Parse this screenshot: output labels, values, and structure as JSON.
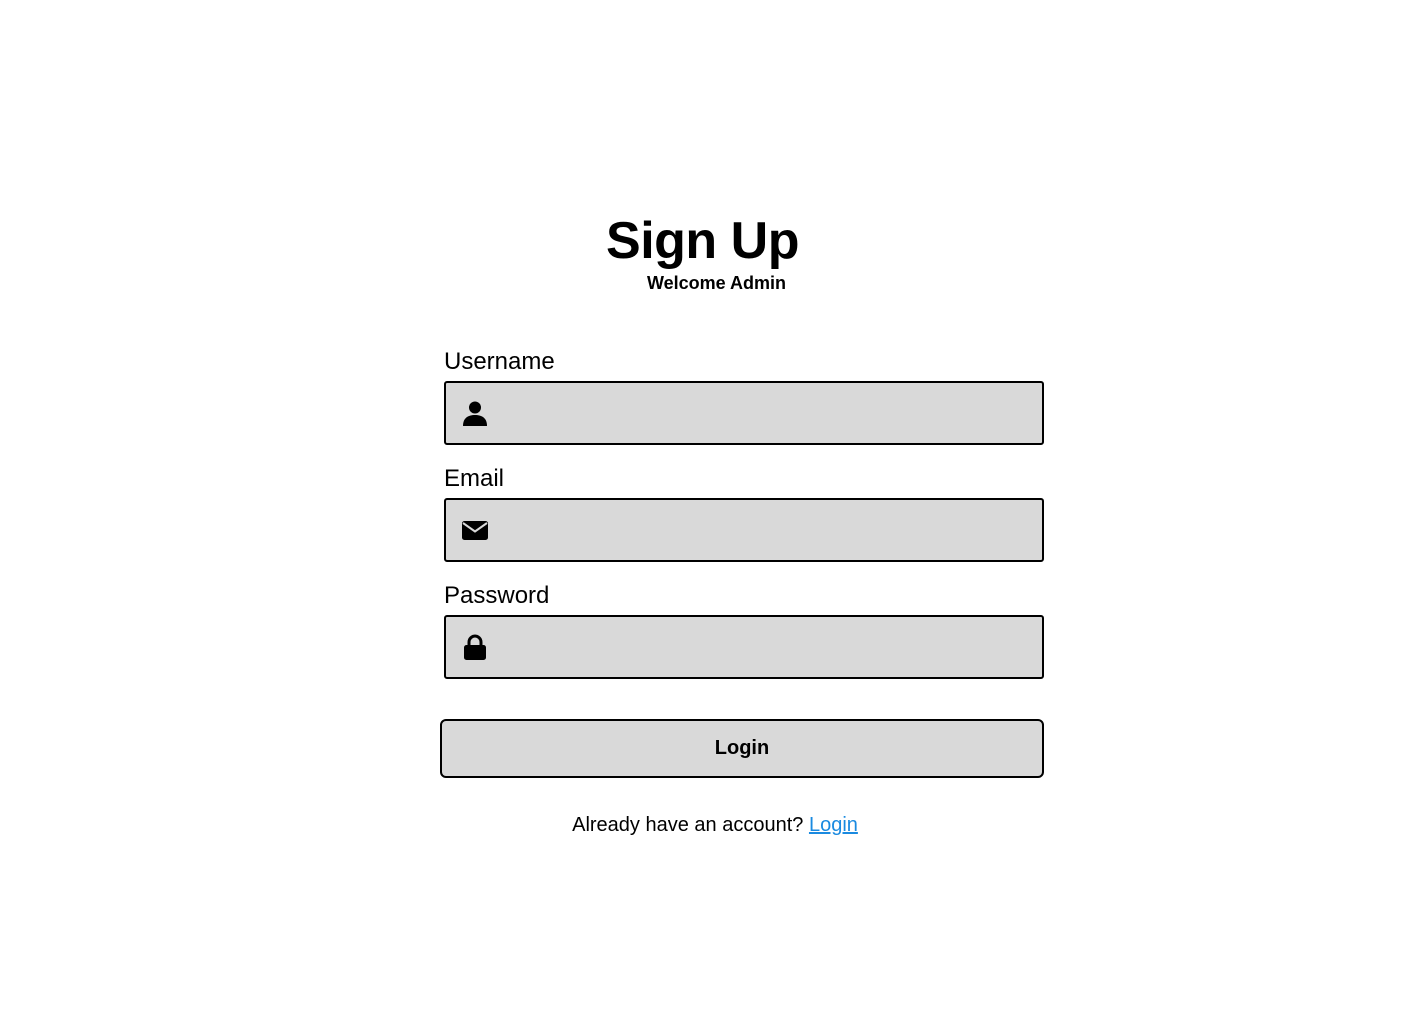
{
  "header": {
    "title": "Sign Up",
    "subtitle": "Welcome Admin"
  },
  "form": {
    "username": {
      "label": "Username",
      "value": "",
      "icon": "user-icon"
    },
    "email": {
      "label": "Email",
      "value": "",
      "icon": "envelope-icon"
    },
    "password": {
      "label": "Password",
      "value": "",
      "icon": "lock-icon"
    },
    "submit_label": "Login"
  },
  "footer": {
    "prompt": "Already have an account?",
    "link_label": "Login"
  },
  "colors": {
    "field_background": "#d9d9d9",
    "border": "#000000",
    "link": "#1a8ae0",
    "background": "#ffffff"
  }
}
